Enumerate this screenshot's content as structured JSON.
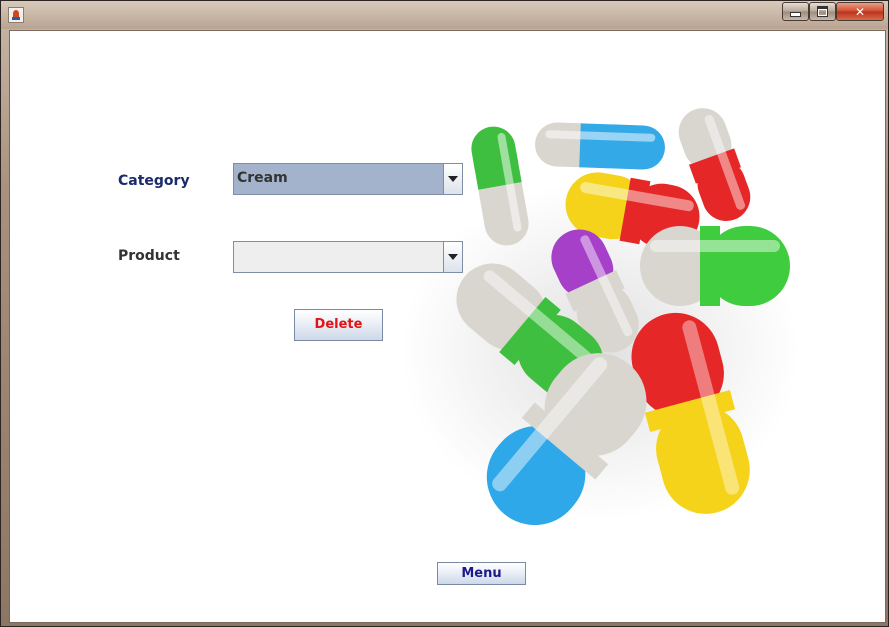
{
  "form": {
    "category_label": "Category",
    "category_value": "Cream",
    "product_label": "Product",
    "product_value": "",
    "delete_label": "Delete",
    "menu_label": "Menu"
  },
  "colors": {
    "category_label": "#1a2a6a",
    "product_label": "#333333",
    "delete_text": "#e01414",
    "menu_text": "#1a1a8a",
    "category_combo_bg": "#a2b3cb",
    "product_combo_bg": "#eeeeee"
  },
  "icons": [
    "java-app-icon",
    "minimize-icon",
    "maximize-icon",
    "close-icon",
    "dropdown-arrow-icon"
  ]
}
